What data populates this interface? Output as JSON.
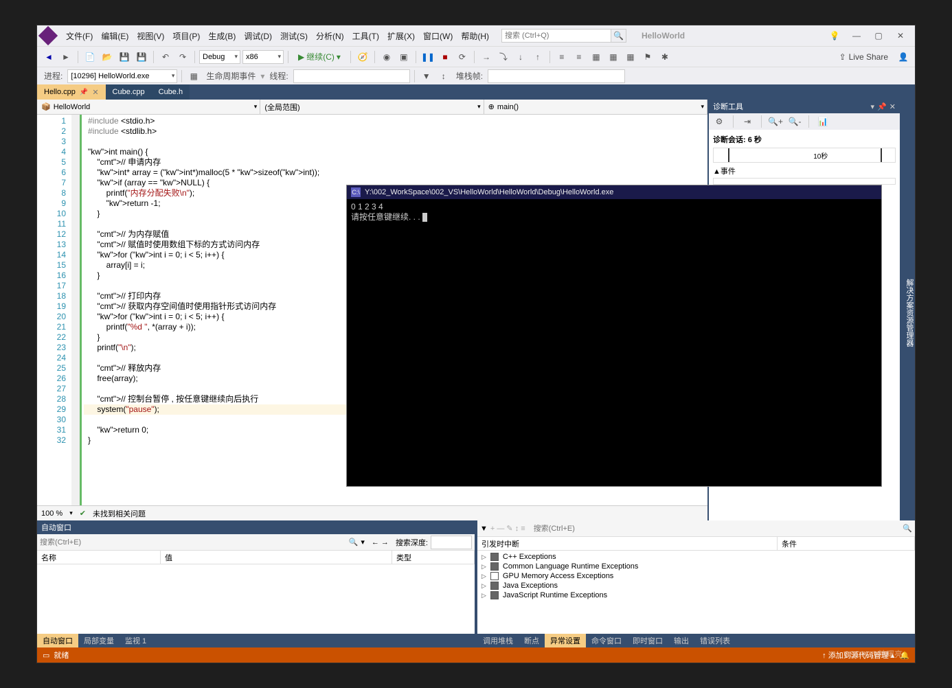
{
  "menu": [
    "文件(F)",
    "编辑(E)",
    "视图(V)",
    "项目(P)",
    "生成(B)",
    "调试(D)",
    "测试(S)",
    "分析(N)",
    "工具(T)",
    "扩展(X)",
    "窗口(W)",
    "帮助(H)"
  ],
  "title_search_placeholder": "搜索 (Ctrl+Q)",
  "solution_name": "HelloWorld",
  "toolbar": {
    "config": "Debug",
    "platform": "x86",
    "continue": "继续(C)",
    "live_share": "Live Share"
  },
  "process_bar": {
    "label": "进程:",
    "value": "[10296] HelloWorld.exe",
    "lifecycle": "生命周期事件",
    "thread": "线程:",
    "stackframe": "堆栈帧:"
  },
  "tabs": [
    {
      "name": "Hello.cpp",
      "active": true,
      "pinned": true
    },
    {
      "name": "Cube.cpp"
    },
    {
      "name": "Cube.h"
    }
  ],
  "editor_nav": {
    "project": "HelloWorld",
    "scope": "(全局范围)",
    "member": "main()"
  },
  "code_lines": [
    "#include <stdio.h>",
    "#include <stdlib.h>",
    "",
    "int main() {",
    "    // 申请内存",
    "    int* array = (int*)malloc(5 * sizeof(int));",
    "    if (array == NULL) {",
    "        printf(\"内存分配失败\\n\");",
    "        return -1;",
    "    }",
    "",
    "    // 为内存赋值",
    "    // 赋值时使用数组下标的方式访问内存",
    "    for (int i = 0; i < 5; i++) {",
    "        array[i] = i;",
    "    }",
    "",
    "    // 打印内存",
    "    // 获取内存空间值时使用指针形式访问内存",
    "    for (int i = 0; i < 5; i++) {",
    "        printf(\"%d \", *(array + i));",
    "    }",
    "    printf(\"\\n\");",
    "",
    "    // 释放内存",
    "    free(array);",
    "",
    "    // 控制台暂停 , 按任意键继续向后执行",
    "    system(\"pause\");",
    "",
    "    return 0;",
    "}"
  ],
  "zoom": "100 %",
  "no_issues": "未找到相关问题",
  "console": {
    "title": "Y:\\002_WorkSpace\\002_VS\\HelloWorld\\HelloWorld\\Debug\\HelloWorld.exe",
    "lines": [
      "0 1 2 3 4",
      "请按任意键继续. . . "
    ]
  },
  "diag": {
    "title": "诊断工具",
    "session": "诊断会话: 6 秒",
    "time_label": "10秒",
    "events": "▲事件"
  },
  "side_strip": "解决方案资源管理器",
  "auto_window": {
    "title": "自动窗口",
    "search": "搜索(Ctrl+E)",
    "depth": "搜索深度:",
    "cols": [
      "名称",
      "值",
      "类型"
    ]
  },
  "exceptions": {
    "search": "搜索(Ctrl+E)",
    "cols": [
      "引发时中断",
      "条件"
    ],
    "items": [
      {
        "name": "C++ Exceptions",
        "checked": true
      },
      {
        "name": "Common Language Runtime Exceptions",
        "checked": true
      },
      {
        "name": "GPU Memory Access Exceptions",
        "checked": false
      },
      {
        "name": "Java Exceptions",
        "checked": true
      },
      {
        "name": "JavaScript Runtime Exceptions",
        "checked": true
      }
    ]
  },
  "left_tabs": [
    "自动窗口",
    "局部变量",
    "监视 1"
  ],
  "right_tabs": [
    "调用堆栈",
    "断点",
    "异常设置",
    "命令窗口",
    "即时窗口",
    "输出",
    "错误列表"
  ],
  "right_active": "异常设置",
  "status": {
    "text": "就绪",
    "source": "添加到源代码管理"
  },
  "watermark": "CSDN @韩曙亮"
}
